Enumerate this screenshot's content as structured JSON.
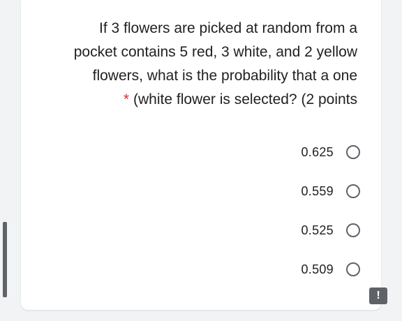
{
  "question": {
    "line1": "If 3 flowers are picked at random from a",
    "line2": "pocket contains 5 red, 3 white, and 2 yellow",
    "line3": "flowers, what is the probability that a one",
    "line4": "(white flower is selected? (2 points",
    "required_marker": "*"
  },
  "options": [
    {
      "label": "0.625"
    },
    {
      "label": "0.559"
    },
    {
      "label": "0.525"
    },
    {
      "label": "0.509"
    }
  ],
  "report_button": {
    "icon": "exclamation-icon",
    "symbol": "!"
  }
}
